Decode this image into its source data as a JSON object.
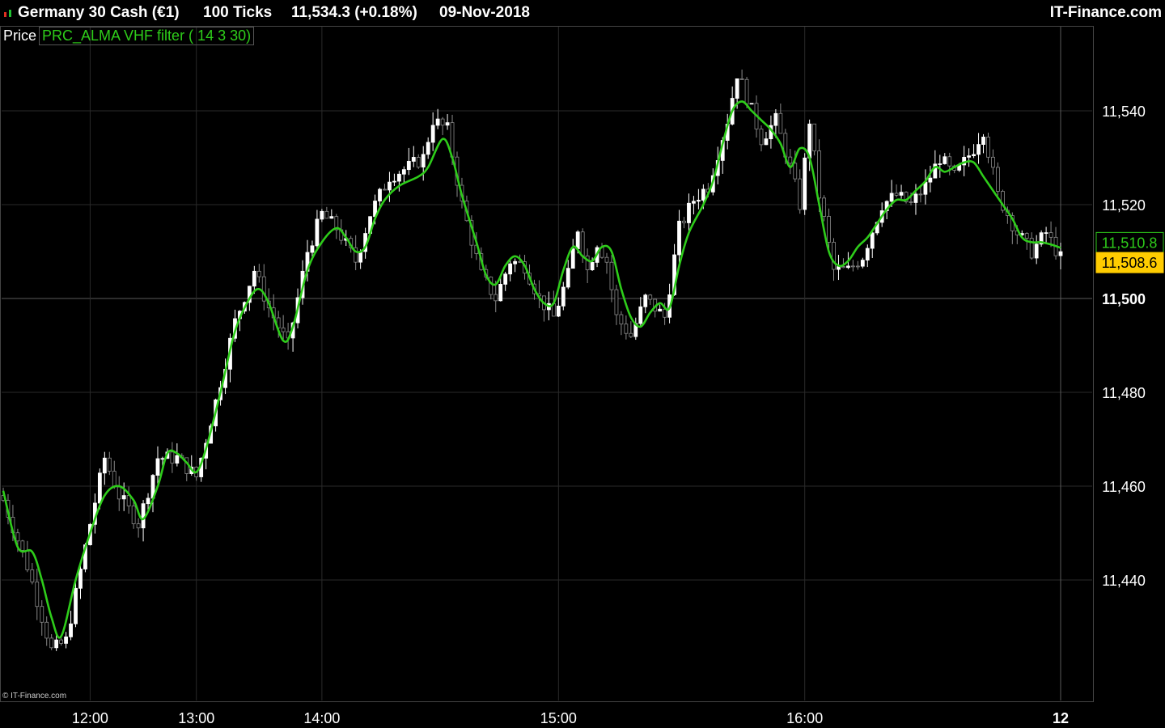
{
  "header": {
    "instrument": "Germany 30 Cash (€1)",
    "timeframe": "100 Ticks",
    "quote": "11,534.3 (+0.18%)",
    "date": "09-Nov-2018",
    "brand": "IT-Finance.com",
    "icon": "bar-chart-icon"
  },
  "legend": {
    "price_label": "Price",
    "indicator_label": "PRC_ALMA VHF filter ( 14 3 30)"
  },
  "copyright": "© IT-Finance.com",
  "colors": {
    "background": "#000000",
    "grid": "#2a2a2a",
    "candle_up": "#ffffff",
    "candle_down": "#8a8a8a",
    "indicator": "#2ecc1a",
    "price_badge_bg": "#ffcc00",
    "price_badge_text": "#000000"
  },
  "chart_data": {
    "type": "candlestick",
    "ylim": [
      11420,
      11555
    ],
    "yticks": [
      {
        "value": 11440,
        "label": "11,440"
      },
      {
        "value": 11460,
        "label": "11,460"
      },
      {
        "value": 11480,
        "label": "11,480"
      },
      {
        "value": 11500,
        "label": "11,500",
        "bold": true
      },
      {
        "value": 11520,
        "label": "11,520"
      },
      {
        "value": 11540,
        "label": "11,540"
      }
    ],
    "xticks": [
      {
        "bar": 18,
        "label": "12:00"
      },
      {
        "bar": 40,
        "label": "13:00"
      },
      {
        "bar": 66,
        "label": "14:00"
      },
      {
        "bar": 115,
        "label": "15:00"
      },
      {
        "bar": 166,
        "label": "16:00"
      },
      {
        "bar": 219,
        "label": "12",
        "bold": true
      }
    ],
    "bar_count": 220,
    "close_path": [
      [
        0,
        11457
      ],
      [
        5,
        11443
      ],
      [
        10,
        11425
      ],
      [
        13,
        11427
      ],
      [
        18,
        11452
      ],
      [
        21,
        11466
      ],
      [
        24,
        11458
      ],
      [
        28,
        11452
      ],
      [
        32,
        11466
      ],
      [
        36,
        11466
      ],
      [
        40,
        11462
      ],
      [
        44,
        11478
      ],
      [
        48,
        11495
      ],
      [
        52,
        11506
      ],
      [
        55,
        11498
      ],
      [
        59,
        11490
      ],
      [
        63,
        11510
      ],
      [
        66,
        11518
      ],
      [
        69,
        11515
      ],
      [
        73,
        11508
      ],
      [
        76,
        11518
      ],
      [
        80,
        11526
      ],
      [
        84,
        11528
      ],
      [
        87,
        11530
      ],
      [
        89,
        11538
      ],
      [
        92,
        11536
      ],
      [
        95,
        11520
      ],
      [
        99,
        11505
      ],
      [
        102,
        11500
      ],
      [
        105,
        11508
      ],
      [
        108,
        11507
      ],
      [
        111,
        11500
      ],
      [
        114,
        11496
      ],
      [
        117,
        11505
      ],
      [
        119,
        11515
      ],
      [
        121,
        11506
      ],
      [
        123,
        11512
      ],
      [
        125,
        11508
      ],
      [
        127,
        11496
      ],
      [
        130,
        11492
      ],
      [
        133,
        11500
      ],
      [
        137,
        11496
      ],
      [
        140,
        11515
      ],
      [
        143,
        11521
      ],
      [
        146,
        11524
      ],
      [
        150,
        11538
      ],
      [
        152,
        11548
      ],
      [
        154,
        11543
      ],
      [
        157,
        11534
      ],
      [
        160,
        11538
      ],
      [
        163,
        11528
      ],
      [
        165,
        11520
      ],
      [
        167,
        11538
      ],
      [
        169,
        11522
      ],
      [
        172,
        11506
      ],
      [
        175,
        11506
      ],
      [
        178,
        11509
      ],
      [
        182,
        11520
      ],
      [
        185,
        11522
      ],
      [
        188,
        11520
      ],
      [
        191,
        11524
      ],
      [
        194,
        11530
      ],
      [
        197,
        11526
      ],
      [
        201,
        11532
      ],
      [
        203,
        11536
      ],
      [
        206,
        11522
      ],
      [
        210,
        11514
      ],
      [
        213,
        11510
      ],
      [
        216,
        11514
      ],
      [
        219,
        11508.6
      ]
    ],
    "series": [
      {
        "name": "PRC_ALMA VHF filter ( 14 3 30)",
        "type": "line",
        "points": [
          [
            0,
            11459
          ],
          [
            3,
            11447
          ],
          [
            6,
            11446
          ],
          [
            8,
            11440
          ],
          [
            10,
            11432
          ],
          [
            12,
            11428
          ],
          [
            15,
            11440
          ],
          [
            18,
            11450
          ],
          [
            21,
            11458
          ],
          [
            24,
            11460
          ],
          [
            27,
            11457
          ],
          [
            29,
            11453
          ],
          [
            32,
            11460
          ],
          [
            34,
            11467
          ],
          [
            36,
            11467
          ],
          [
            38,
            11465
          ],
          [
            40,
            11463
          ],
          [
            42,
            11468
          ],
          [
            45,
            11480
          ],
          [
            48,
            11493
          ],
          [
            51,
            11500
          ],
          [
            53,
            11502
          ],
          [
            55,
            11499
          ],
          [
            58,
            11491
          ],
          [
            60,
            11494
          ],
          [
            63,
            11506
          ],
          [
            66,
            11512
          ],
          [
            69,
            11515
          ],
          [
            71,
            11513
          ],
          [
            73,
            11510
          ],
          [
            75,
            11511
          ],
          [
            77,
            11517
          ],
          [
            79,
            11521
          ],
          [
            82,
            11524
          ],
          [
            86,
            11526
          ],
          [
            88,
            11528
          ],
          [
            91,
            11534
          ],
          [
            93,
            11530
          ],
          [
            95,
            11522
          ],
          [
            98,
            11512
          ],
          [
            100,
            11505
          ],
          [
            102,
            11503
          ],
          [
            104,
            11507
          ],
          [
            106,
            11509
          ],
          [
            108,
            11507
          ],
          [
            110,
            11502
          ],
          [
            112,
            11499
          ],
          [
            114,
            11499
          ],
          [
            116,
            11506
          ],
          [
            118,
            11511
          ],
          [
            120,
            11509
          ],
          [
            122,
            11508
          ],
          [
            124,
            11511
          ],
          [
            126,
            11510
          ],
          [
            128,
            11502
          ],
          [
            130,
            11496
          ],
          [
            132,
            11494
          ],
          [
            134,
            11497
          ],
          [
            136,
            11499
          ],
          [
            138,
            11498
          ],
          [
            140,
            11507
          ],
          [
            142,
            11514
          ],
          [
            145,
            11520
          ],
          [
            147,
            11525
          ],
          [
            149,
            11533
          ],
          [
            151,
            11540
          ],
          [
            153,
            11542
          ],
          [
            155,
            11540
          ],
          [
            157,
            11538
          ],
          [
            159,
            11536
          ],
          [
            161,
            11533
          ],
          [
            163,
            11528
          ],
          [
            165,
            11532
          ],
          [
            167,
            11530
          ],
          [
            169,
            11520
          ],
          [
            171,
            11510
          ],
          [
            173,
            11507
          ],
          [
            175,
            11508
          ],
          [
            177,
            11511
          ],
          [
            179,
            11513
          ],
          [
            181,
            11516
          ],
          [
            183,
            11519
          ],
          [
            185,
            11521
          ],
          [
            187,
            11521
          ],
          [
            189,
            11523
          ],
          [
            191,
            11525
          ],
          [
            193,
            11528
          ],
          [
            195,
            11527
          ],
          [
            197,
            11528
          ],
          [
            199,
            11529
          ],
          [
            201,
            11529
          ],
          [
            203,
            11526
          ],
          [
            205,
            11523
          ],
          [
            207,
            11520
          ],
          [
            209,
            11517
          ],
          [
            211,
            11513
          ],
          [
            213,
            11512
          ],
          [
            215,
            11512
          ],
          [
            217,
            11511.5
          ],
          [
            219,
            11510.8
          ]
        ]
      }
    ],
    "price_badges": [
      {
        "value": 11510.8,
        "label": "11,510.8",
        "role": "indicator"
      },
      {
        "value": 11508.6,
        "label": "11,508.6",
        "role": "last-price"
      }
    ]
  }
}
